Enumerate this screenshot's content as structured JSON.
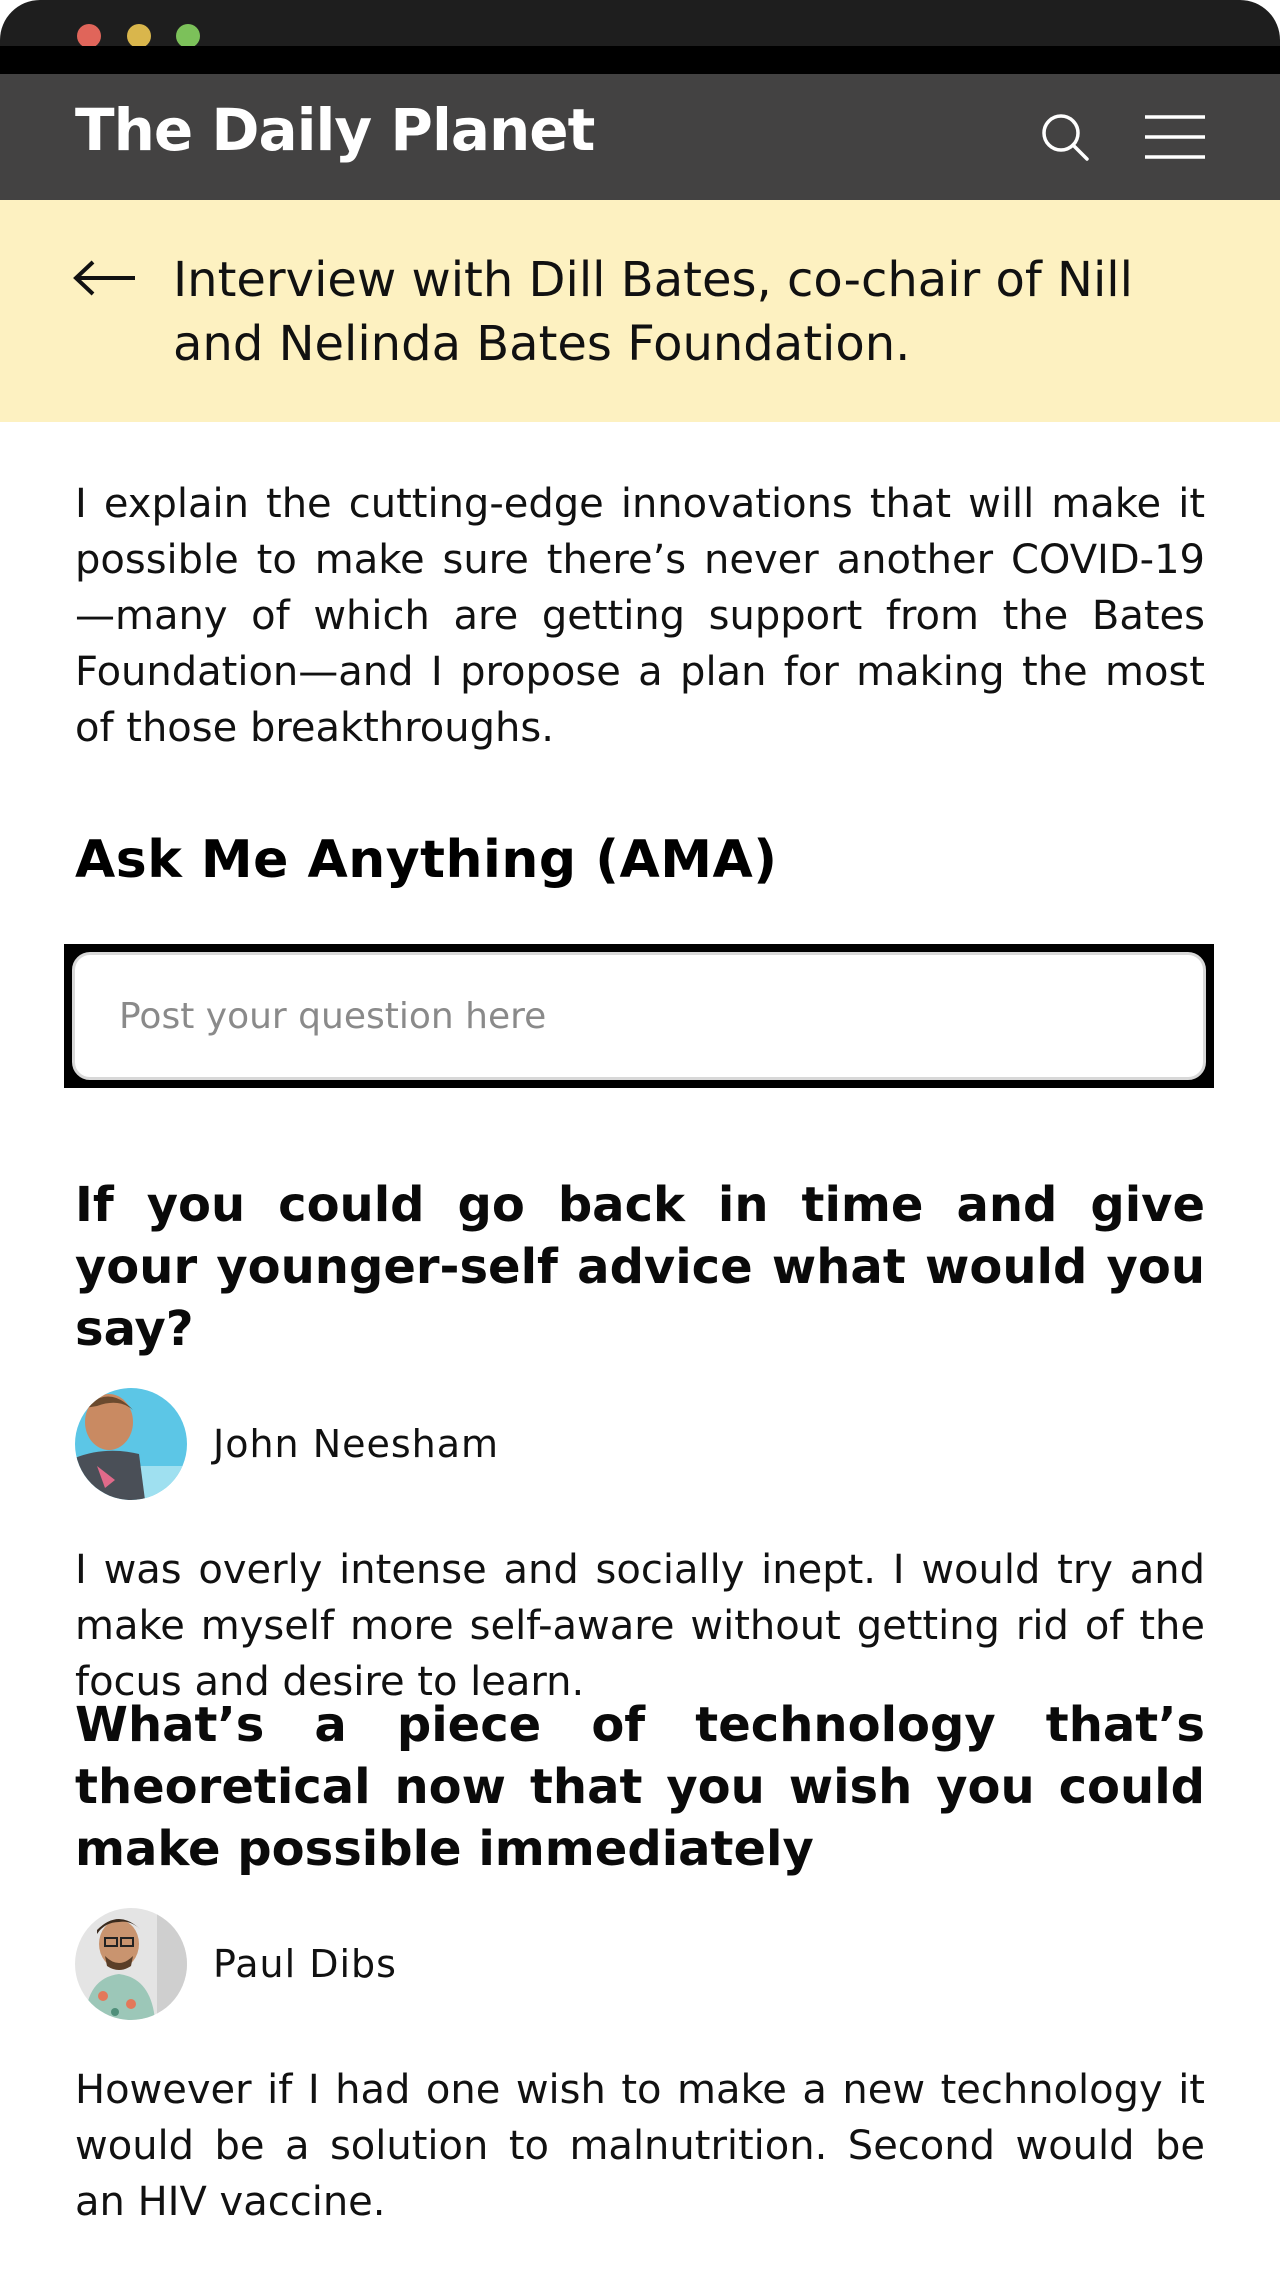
{
  "window": {
    "controls": [
      "close",
      "minimize",
      "maximize"
    ]
  },
  "header": {
    "brand": "The Daily Planet",
    "search_icon": "search-icon",
    "menu_icon": "hamburger-menu-icon"
  },
  "banner": {
    "title": "Interview with Dill Bates, co-chair of Nill and Nelinda Bates Foundation."
  },
  "intro": "I explain the cutting-edge innovations that will make it possible to make sure there’s never another COVID-19—many of which are getting support from the Bates Foundation—and I propose a plan for making the most of those breakthroughs.",
  "ama": {
    "title": "Ask Me Anything (AMA)",
    "input_placeholder": "Post your question here",
    "input_value": ""
  },
  "qa": [
    {
      "question": "If you could go back in time and give your younger-self advice what would you say?",
      "author": "John Neesham",
      "answer": "I was overly intense and socially inept. I would try and make myself more self-aware without getting rid of the focus and desire to learn."
    },
    {
      "question": "What’s a piece of technology that’s theoretical now that you wish you could make possible immediately",
      "author": "Paul Dibs",
      "answer": "However if I had one wish to make a new technology it would be a solution to malnutrition. Second would be an HIV vaccine."
    }
  ],
  "colors": {
    "header_bg": "#434242",
    "banner_bg": "#fdf1c1",
    "titlebar_bg": "#1e1e1e"
  }
}
